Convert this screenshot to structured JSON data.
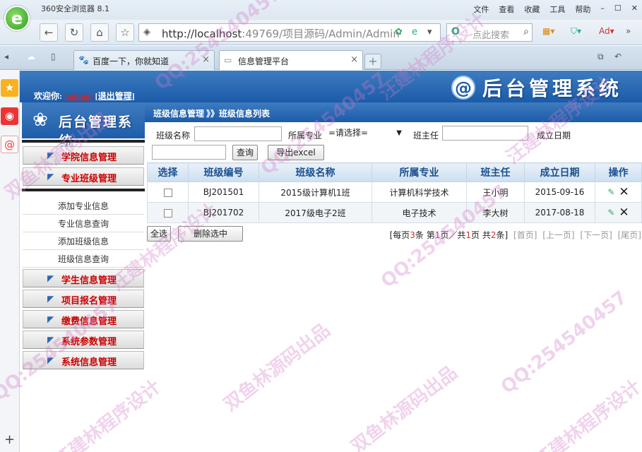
{
  "browser": {
    "title": "360安全浏览器 8.1",
    "menu": [
      "文件",
      "查看",
      "收藏",
      "工具",
      "帮助"
    ],
    "url_host": "http://localhost",
    "url_rest": ":49769/项目源码/Admin/Admin",
    "search_placeholder": "点此搜索",
    "tabs": [
      {
        "label": "百度一下，你就知道",
        "icon": "paw-icon"
      },
      {
        "label": "信息管理平台",
        "icon": "page-icon"
      }
    ]
  },
  "header": {
    "welcome": "欢迎你:",
    "user": "[admin]",
    "logout": "[退出管理]",
    "brand": "后台管理系统",
    "side_brand": "后台管理系统"
  },
  "nav": {
    "groups_top": [
      "学院信息管理",
      "专业班级管理"
    ],
    "sub_items": [
      "添加专业信息",
      "专业信息查询",
      "添加班级信息",
      "班级信息查询"
    ],
    "groups_bottom": [
      "学生信息管理",
      "项目报名管理",
      "缴费信息管理",
      "系统参数管理",
      "系统信息管理"
    ]
  },
  "breadcrumb": "班级信息管理 》》班级信息列表",
  "filter": {
    "class_name_label": "班级名称",
    "major_label": "所属专业",
    "major_selected": "=请选择=",
    "teacher_label": "班主任",
    "date_label": "成立日期",
    "search_btn": "查询",
    "export_btn": "导出excel"
  },
  "table": {
    "headers": [
      "选择",
      "班级编号",
      "班级名称",
      "所属专业",
      "班主任",
      "成立日期",
      "操作"
    ],
    "rows": [
      {
        "code": "BJ201501",
        "name": "2015级计算机1班",
        "major": "计算机科学技术",
        "teacher": "王小明",
        "date": "2015-09-16"
      },
      {
        "code": "BJ201702",
        "name": "2017级电子2班",
        "major": "电子技术",
        "teacher": "李大树",
        "date": "2017-08-18"
      }
    ]
  },
  "footer": {
    "select_all": "全选",
    "delete_selected": "删除选中",
    "pager_prefix": "[每页",
    "per_page": "3",
    "pager_mid1": "条 第",
    "page": "1",
    "pager_mid2": "页／共",
    "total_pages": "1",
    "pager_mid3": "页 共",
    "total": "2",
    "pager_suffix": "条]",
    "first": "[首页]",
    "prev": "[上一页]",
    "next": "[下一页]",
    "last": "[尾页]"
  },
  "watermarks": [
    "QQ:254540457",
    "汪建林程序设计",
    "双鱼林源码出品"
  ],
  "colors": {
    "accent": "#1b5ba8",
    "nav_label": "#cc0000"
  }
}
